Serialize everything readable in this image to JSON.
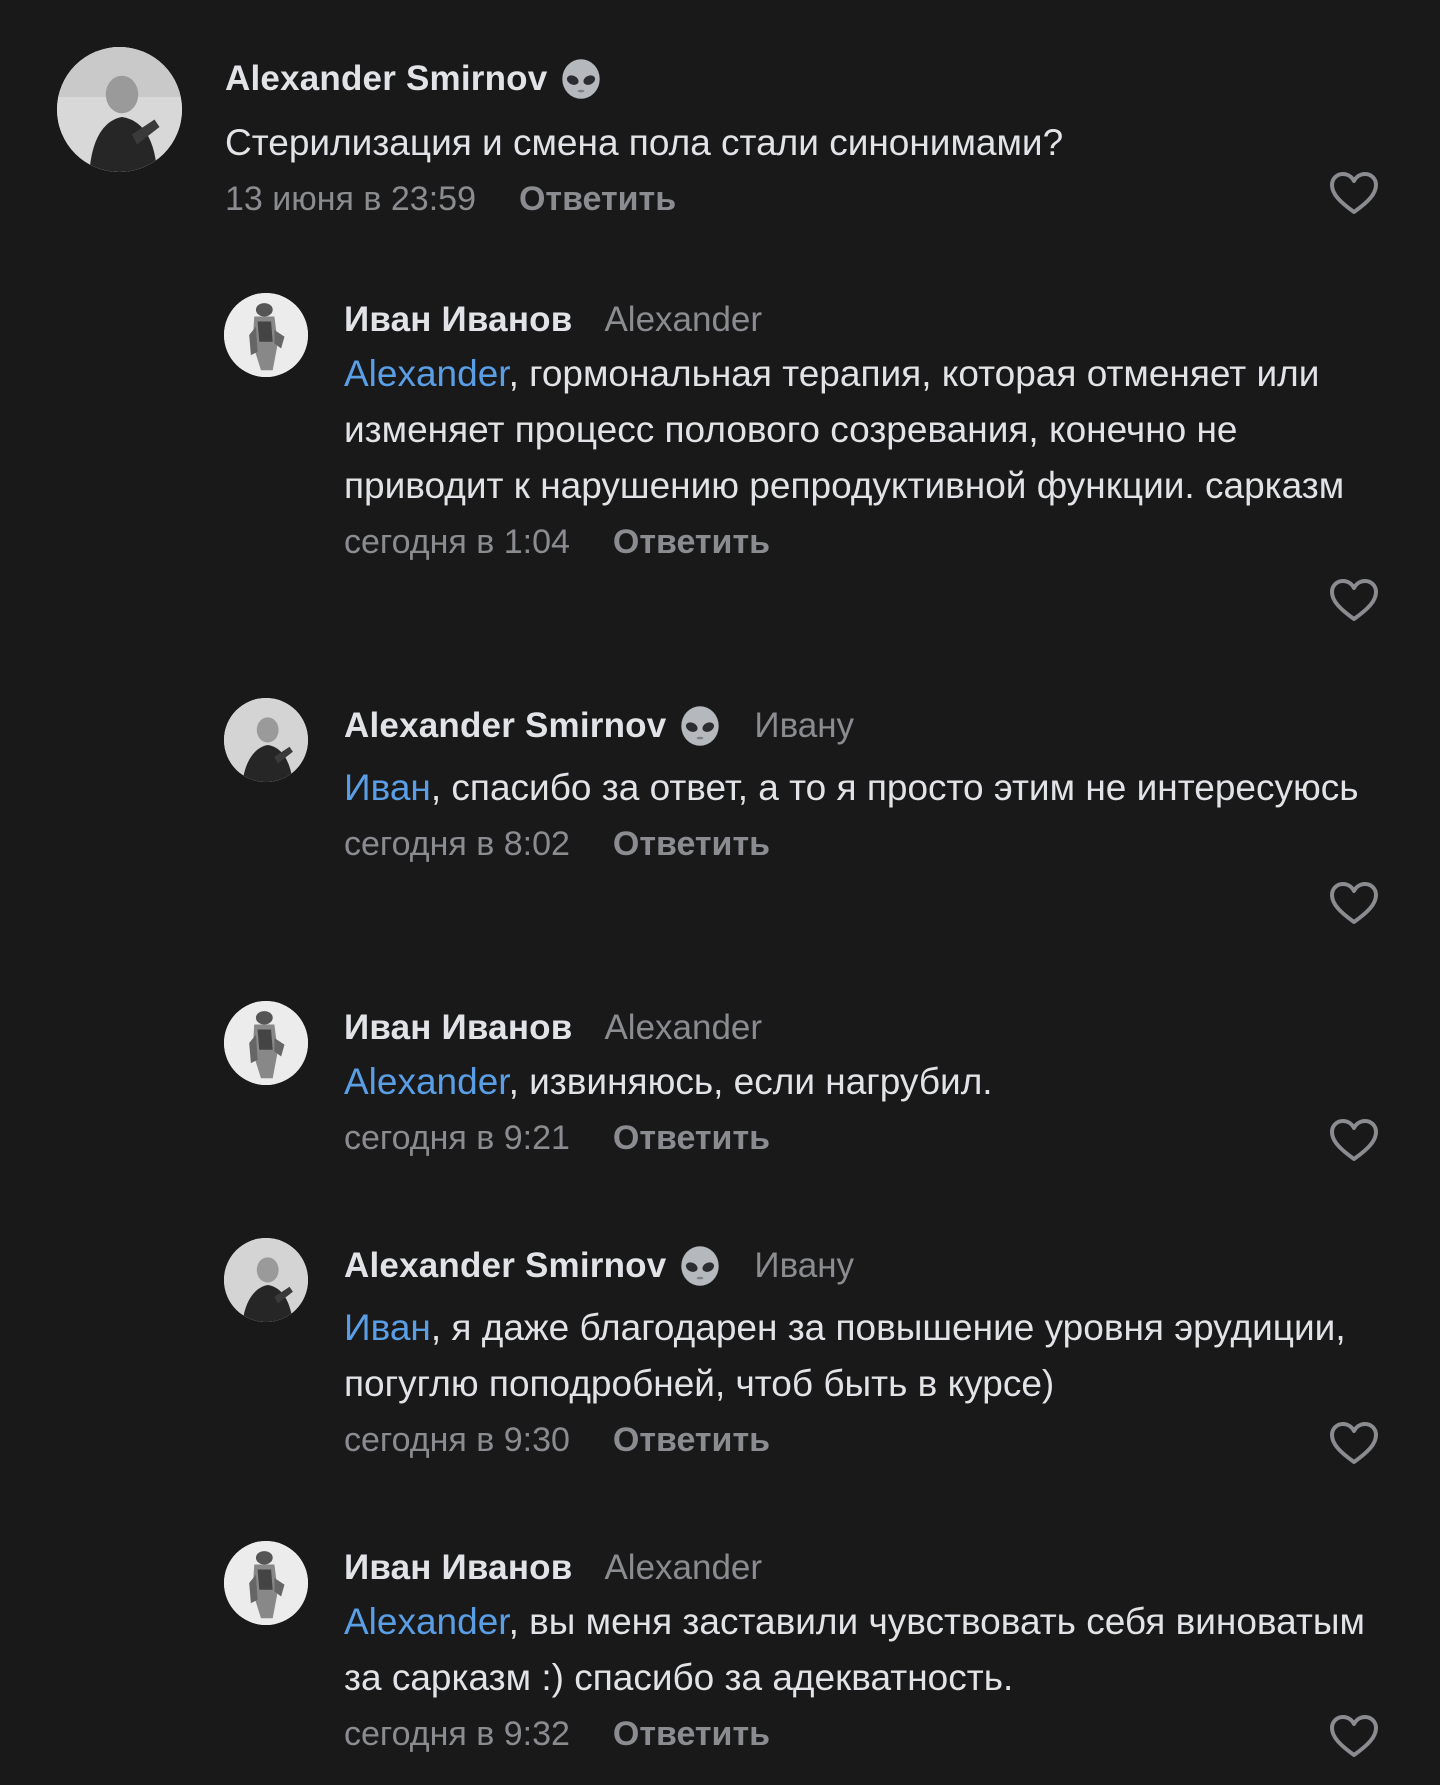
{
  "comments": [
    {
      "author": "Alexander Smirnov",
      "author_icon": "alien-emoji-icon",
      "reply_to": "",
      "mention": "",
      "text": "Стерилизация и смена пола стали синонимами?",
      "timestamp": "13 июня в 23:59",
      "reply_label": "Ответить",
      "like_icon": "heart-outline-icon"
    },
    {
      "author": "Иван Иванов",
      "author_icon": "",
      "reply_to": "Alexander",
      "mention": "Alexander",
      "text": ", гормональная терапия, которая отменяет или изменяет процесс полового созревания, конечно не приводит к нарушению репродуктивной функции. сарказм",
      "timestamp": "сегодня в 1:04",
      "reply_label": "Ответить",
      "like_icon": "heart-outline-icon"
    },
    {
      "author": "Alexander Smirnov",
      "author_icon": "alien-emoji-icon",
      "reply_to": "Ивану",
      "mention": "Иван",
      "text": ", спасибо за ответ, а то я просто этим не интересуюсь",
      "timestamp": "сегодня в 8:02",
      "reply_label": "Ответить",
      "like_icon": "heart-outline-icon"
    },
    {
      "author": "Иван Иванов",
      "author_icon": "",
      "reply_to": "Alexander",
      "mention": "Alexander",
      "text": ", извиняюсь, если нагрубил.",
      "timestamp": "сегодня в 9:21",
      "reply_label": "Ответить",
      "like_icon": "heart-outline-icon"
    },
    {
      "author": "Alexander Smirnov",
      "author_icon": "alien-emoji-icon",
      "reply_to": "Ивану",
      "mention": "Иван",
      "text": ", я даже благодарен за повышение уровня эрудиции, погуглю поподробней, чтоб быть в курсе)",
      "timestamp": "сегодня в 9:30",
      "reply_label": "Ответить",
      "like_icon": "heart-outline-icon"
    },
    {
      "author": "Иван Иванов",
      "author_icon": "",
      "reply_to": "Alexander",
      "mention": "Alexander",
      "text": ", вы меня заставили чувствовать себя виноватым за сарказм :) спасибо за адекватность.",
      "timestamp": "сегодня в 9:32",
      "reply_label": "Ответить",
      "like_icon": "heart-outline-icon"
    }
  ],
  "colors": {
    "background": "#19191a",
    "text": "#e1e3e6",
    "secondary": "#8a8c90",
    "mention": "#5a9ee6"
  }
}
